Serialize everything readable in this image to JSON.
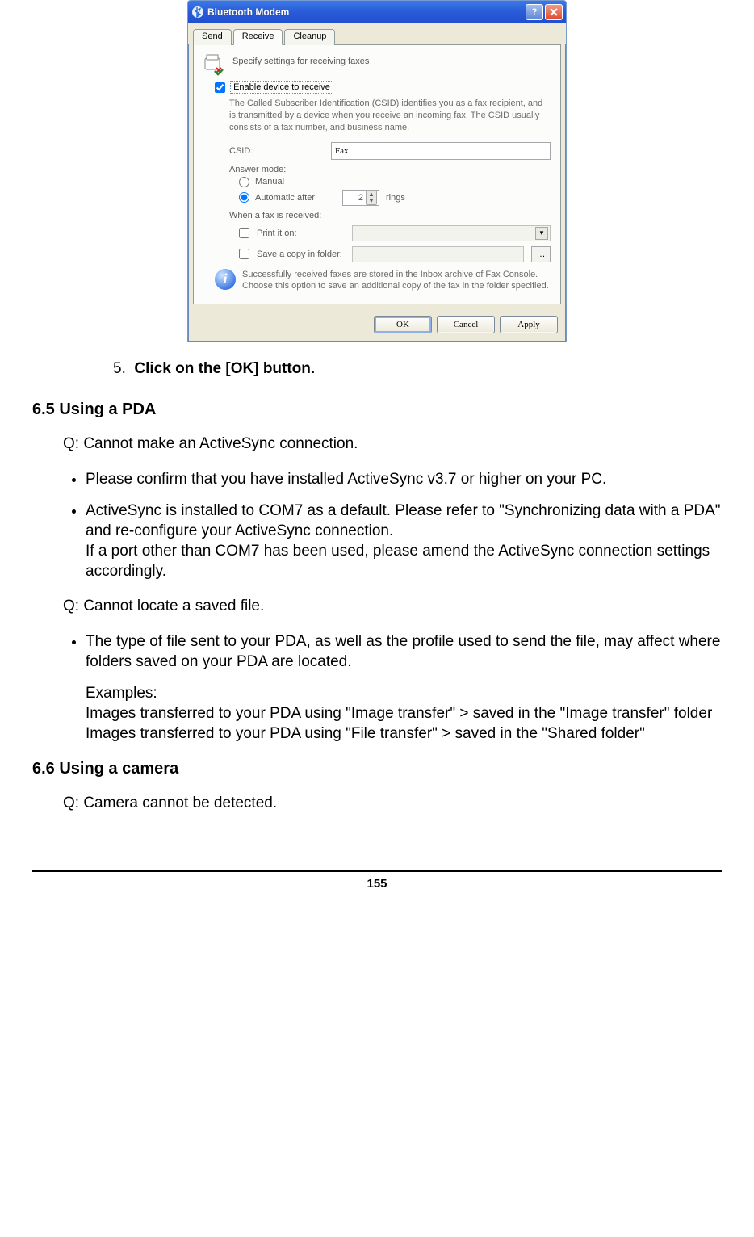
{
  "dialog": {
    "title": "Bluetooth Modem",
    "tabs": {
      "send": "Send",
      "receive": "Receive",
      "cleanup": "Cleanup"
    },
    "header": "Specify settings for receiving faxes",
    "enable_label": "Enable device to receive",
    "csid_help": "The Called Subscriber Identification (CSID) identifies you as a fax recipient, and is transmitted by a device when you receive an incoming fax. The CSID usually consists of a fax number, and business name.",
    "csid": {
      "label": "CSID:",
      "value": "Fax"
    },
    "answer_mode": {
      "label": "Answer mode:",
      "manual": "Manual",
      "auto": "Automatic after",
      "rings_value": "2",
      "rings_label": "rings"
    },
    "when_received": {
      "label": "When a fax is received:",
      "print": "Print it on:",
      "save": "Save a copy in folder:"
    },
    "info_text": "Successfully received faxes are stored in the Inbox archive of Fax Console. Choose this option to save an additional copy of the fax in the folder specified.",
    "buttons": {
      "ok": "OK",
      "cancel": "Cancel",
      "apply": "Apply"
    }
  },
  "doc": {
    "step5_num": "5.",
    "step5_text": "Click on the [OK] button.",
    "section65": "6.5  Using a PDA",
    "q1": "Q: Cannot make an ActiveSync connection.",
    "bul1": "Please confirm that you have installed ActiveSync v3.7 or higher on your PC.",
    "bul2a": "ActiveSync is installed to COM7 as a default. Please refer to \"Synchronizing data with a PDA\" and re-configure your ActiveSync connection.",
    "bul2b": "If a port other than COM7 has been used, please amend the ActiveSync connection settings accordingly.",
    "q2": "Q: Cannot locate a saved file.",
    "bul3": "The type of file sent to your PDA, as well as the profile used to send the file, may affect where folders saved on your PDA are located.",
    "examples_label": "Examples:",
    "ex1": "Images transferred to your PDA using \"Image transfer\" > saved in the \"Image transfer\" folder",
    "ex2": "Images transferred to your PDA using \"File transfer\" > saved in the \"Shared folder\"",
    "section66": "6.6  Using a camera",
    "q3": "Q: Camera cannot be detected.",
    "page_number": "155"
  }
}
